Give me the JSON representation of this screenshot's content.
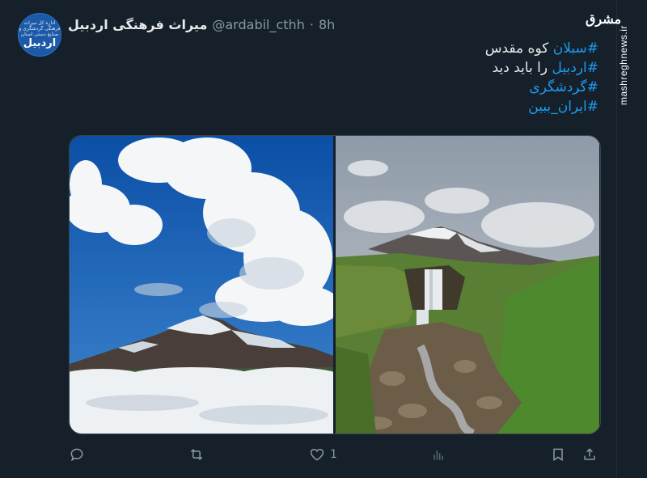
{
  "tweet": {
    "author_name": "میراث فرهنگی اردبیل",
    "handle": "@ardabil_cthh",
    "separator": "·",
    "time": "8h",
    "avatar_text_small": "اداره کل میراث فرهنگی گردشگری و صنایع دستی استان",
    "avatar_text_big": "اردبیل",
    "lines": [
      {
        "tag": "#سبلان",
        "rest": " کوه مقدس"
      },
      {
        "tag": "#اردبیل",
        "rest": " را باید دید"
      },
      {
        "tag": "#گردشگری",
        "rest": ""
      },
      {
        "tag": "#ایران_ببین",
        "rest": ""
      }
    ]
  },
  "actions": {
    "reply_count": "",
    "retweet_count": "",
    "like_count": "1",
    "views_count": ""
  },
  "watermark": {
    "logo": "مشرق",
    "site": "mashreghnews.ir"
  },
  "colors": {
    "background": "#15202b",
    "accent": "#1d9bf0",
    "muted": "#8b98a5"
  },
  "icons": [
    "reply-icon",
    "retweet-icon",
    "like-icon",
    "views-icon",
    "bookmark-icon",
    "share-icon"
  ]
}
